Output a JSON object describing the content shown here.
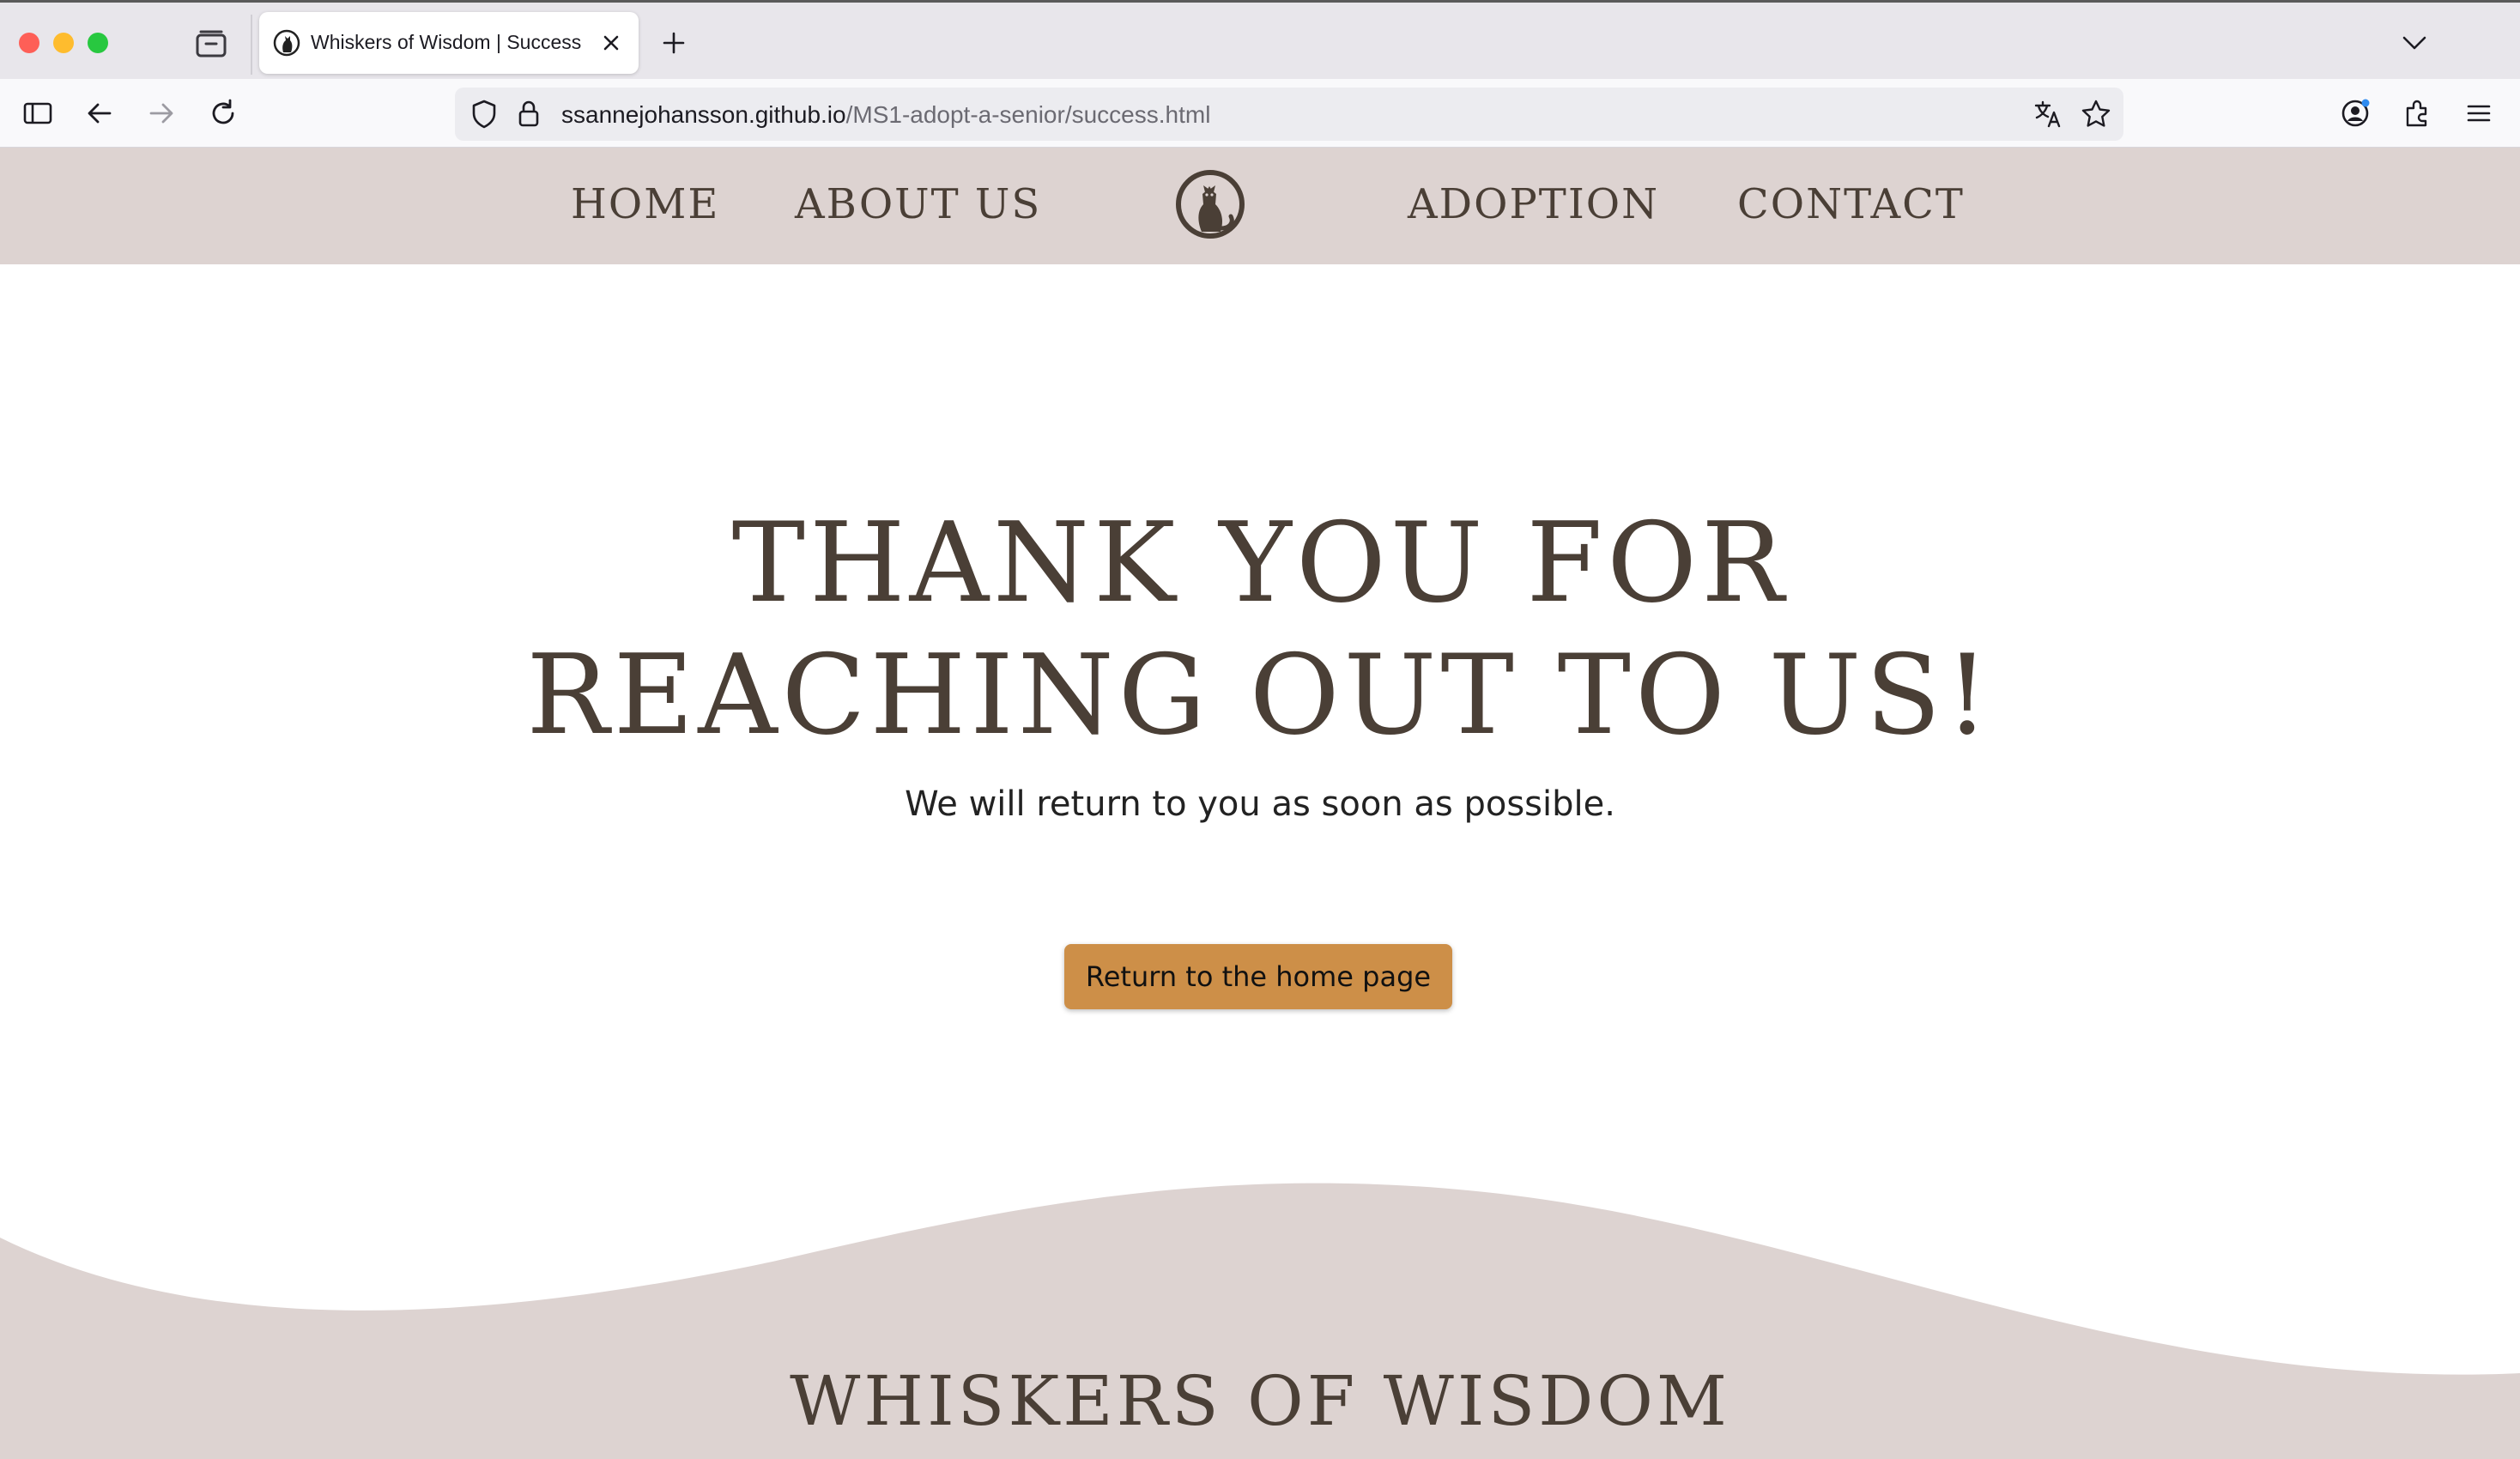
{
  "browser": {
    "tab_title": "Whiskers of Wisdom | Success",
    "url_host": "ssannejohansson.github.io",
    "url_path": "/MS1-adopt-a-senior/success.html"
  },
  "nav": {
    "home": "HOME",
    "about": "ABOUT US",
    "adoption": "ADOPTION",
    "contact": "CONTACT"
  },
  "main": {
    "headline_line1": "THANK YOU FOR",
    "headline_line2": "REACHING OUT TO US!",
    "subtext": "We will return to you as soon as possible.",
    "button_label": "Return to the home page"
  },
  "footer": {
    "title": "WHISKERS OF WISDOM"
  },
  "colors": {
    "header_bg": "#ddd3d1",
    "text": "#4a3f36",
    "button_bg": "#cd8f48"
  }
}
